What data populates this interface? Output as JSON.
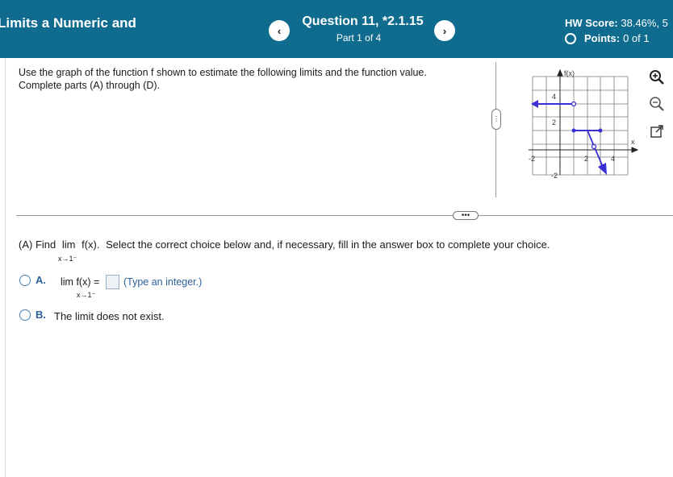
{
  "header": {
    "section_title": "Limits a Numeric and",
    "question_title": "Question 11, *2.1.15",
    "part": "Part 1 of 4",
    "prev_label": "‹",
    "next_label": "›",
    "hw_score_label": "HW Score:",
    "hw_score_value": "38.46%, 5",
    "points_label": "Points:",
    "points_value": "0 of 1"
  },
  "instructions": {
    "line1": "Use the graph of the function f shown to estimate the following limits and the function value.",
    "line2": "Complete parts (A) through (D)."
  },
  "graph": {
    "y_axis_label": "f(x)",
    "x_axis_label": "x",
    "ticks": [
      "4",
      "2",
      "-2",
      "2",
      "4",
      "-2"
    ]
  },
  "question": {
    "prefix": "(A) Find",
    "lim": "lim",
    "expr": "f(x).",
    "instruction": "Select the correct choice below and, if necessary, fill in the answer box to complete your choice.",
    "sub": "x→1⁻"
  },
  "choices": {
    "a_letter": "A.",
    "a_expr": "lim  f(x) =",
    "a_sub": "x→1⁻",
    "a_hint": "(Type an integer.)",
    "b_letter": "B.",
    "b_text": "The limit does not exist."
  },
  "colors": {
    "header_bg": "#0f6c8f",
    "curve": "#3a2fd6",
    "accent": "#2d5f9a"
  }
}
